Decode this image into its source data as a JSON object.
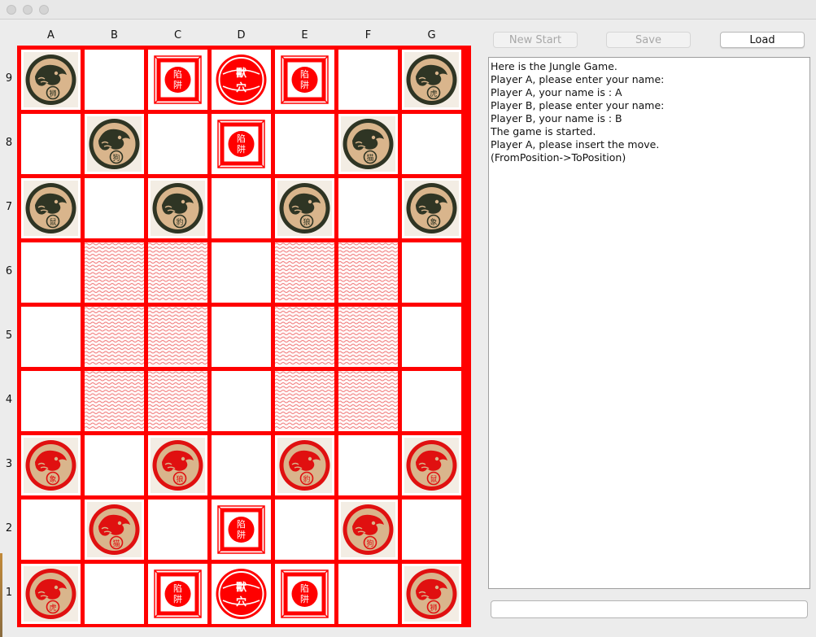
{
  "window": {
    "buttons": [
      "close-button",
      "minimize-button",
      "zoom-button"
    ]
  },
  "board": {
    "columns": [
      "A",
      "B",
      "C",
      "D",
      "E",
      "F",
      "G"
    ],
    "rows": [
      "9",
      "8",
      "7",
      "6",
      "5",
      "4",
      "3",
      "2",
      "1"
    ],
    "colors": {
      "grid": "#ff0000",
      "red_piece": "#e01010",
      "black_piece": "#2f3524",
      "piece_face": "#d9b58c"
    },
    "cells": [
      [
        "black-lion",
        "",
        "trap-red",
        "den-red",
        "trap-red",
        "",
        "black-tiger"
      ],
      [
        "",
        "black-dog",
        "",
        "trap-red",
        "",
        "black-cat",
        ""
      ],
      [
        "black-rat",
        "",
        "black-leopard",
        "",
        "black-wolf",
        "",
        "black-elephant"
      ],
      [
        "",
        "water",
        "water",
        "",
        "water",
        "water",
        ""
      ],
      [
        "",
        "water",
        "water",
        "",
        "water",
        "water",
        ""
      ],
      [
        "",
        "water",
        "water",
        "",
        "water",
        "water",
        ""
      ],
      [
        "red-elephant",
        "",
        "red-wolf",
        "",
        "red-leopard",
        "",
        "red-rat"
      ],
      [
        "",
        "red-cat",
        "",
        "trap-red",
        "",
        "red-dog",
        ""
      ],
      [
        "red-tiger",
        "",
        "trap-red",
        "den-red",
        "trap-red",
        "",
        "red-lion"
      ]
    ],
    "piece_chars": {
      "rat": "鼠",
      "cat": "猫",
      "dog": "狗",
      "wolf": "狼",
      "leopard": "豹",
      "tiger": "虎",
      "lion": "狮",
      "elephant": "象"
    },
    "trap_chars": "陷阱",
    "den_chars": "獸穴"
  },
  "toolbar": {
    "new_start_label": "New Start",
    "save_label": "Save",
    "load_label": "Load"
  },
  "console": {
    "lines": [
      "Here is the Jungle Game.",
      "Player A, please enter your name:",
      "Player A, your name is : A",
      "Player B, please enter your name:",
      "Player B, your name is : B",
      "The game is started.",
      "Player A, please insert the move.",
      "(FromPosition->ToPosition)"
    ]
  },
  "command_input": {
    "value": ""
  }
}
